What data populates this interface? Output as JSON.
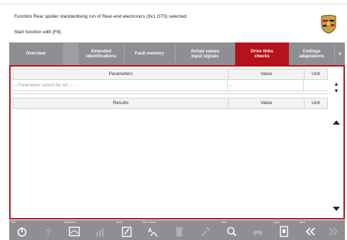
{
  "header": {
    "message_line1": "Function Rear spoiler standardising run of Rear-end electronics (9x1 GT5) selected.",
    "message_line2": "Start function with [F8]."
  },
  "tabs": [
    {
      "label": "Overview"
    },
    {
      "label": ""
    },
    {
      "label": "Extended\nidentifications"
    },
    {
      "label": "Fault memory"
    },
    {
      "label": "Actual values\ninput signals"
    },
    {
      "label": "Drive links\nchecks",
      "active": true
    },
    {
      "label": "Codings\nadaptations"
    },
    {
      "label": "»"
    }
  ],
  "parameters_table": {
    "headers": {
      "col1": "Parameters",
      "col2": "Value",
      "col3": "Unit"
    },
    "row": {
      "name": "--- Parameters cannot be set ---",
      "value": "---",
      "unit": ""
    }
  },
  "results_table": {
    "headers": {
      "col1": "Results",
      "col2": "Value",
      "col3": "Unit"
    }
  },
  "toolbar": [
    {
      "label": "Exit",
      "icon": "power-icon",
      "enabled": true
    },
    {
      "label": "",
      "icon": "help-icon",
      "enabled": false
    },
    {
      "label": "Multimeter",
      "icon": "multimeter-icon",
      "enabled": true
    },
    {
      "label": "",
      "icon": "bar-chart-icon",
      "enabled": false
    },
    {
      "label": "Save",
      "icon": "save-icon",
      "enabled": true
    },
    {
      "label": "Save values",
      "icon": "save-values-icon",
      "enabled": true
    },
    {
      "label": "",
      "icon": "trash-icon",
      "enabled": false
    },
    {
      "label": "",
      "icon": "wrench-icon",
      "enabled": false
    },
    {
      "label": "Start",
      "icon": "start-icon",
      "enabled": true
    },
    {
      "label": "",
      "icon": "car-icon",
      "enabled": false
    },
    {
      "label": "Login",
      "icon": "login-icon",
      "enabled": true
    },
    {
      "label": "Back",
      "icon": "back-icon",
      "enabled": true
    },
    {
      "label": "",
      "icon": "forward-icon",
      "enabled": false
    }
  ],
  "colors": {
    "accent": "#b5121b",
    "bar": "#8d8f92"
  }
}
